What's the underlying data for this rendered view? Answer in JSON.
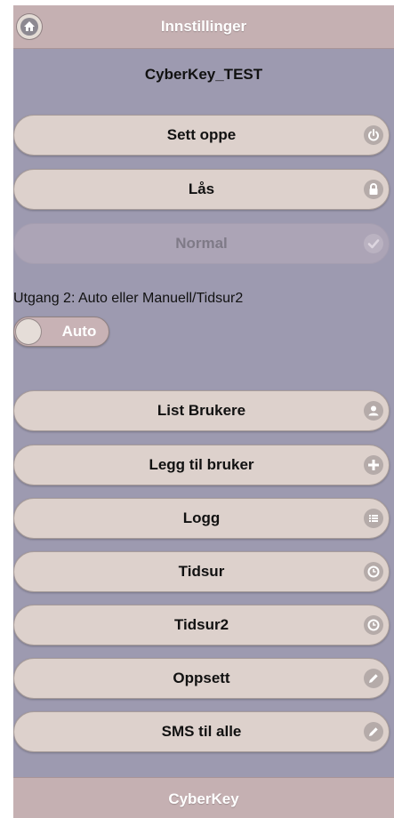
{
  "header": {
    "title": "Innstillinger",
    "home_icon": "home-icon"
  },
  "device": {
    "name": "CyberKey_TEST"
  },
  "actions": {
    "arm": {
      "label": "Sett oppe",
      "icon": "power-icon"
    },
    "lock": {
      "label": "Lås",
      "icon": "lock-icon"
    },
    "normal": {
      "label": "Normal",
      "icon": "check-icon",
      "disabled": true
    }
  },
  "output2": {
    "label": "Utgang 2: Auto eller Manuell/Tidsur2",
    "toggle_label": "Auto",
    "state": "off"
  },
  "menu": [
    {
      "label": "List Brukere",
      "icon": "user-icon"
    },
    {
      "label": "Legg til bruker",
      "icon": "plus-icon"
    },
    {
      "label": "Logg",
      "icon": "list-icon"
    },
    {
      "label": "Tidsur",
      "icon": "clock-icon"
    },
    {
      "label": "Tidsur2",
      "icon": "clock-icon"
    },
    {
      "label": "Oppsett",
      "icon": "edit-icon"
    },
    {
      "label": "SMS til alle",
      "icon": "edit-icon"
    }
  ],
  "footer": {
    "title": "CyberKey"
  },
  "colors": {
    "background": "#9d9ab0",
    "bar": "#c5b0b2",
    "button": "#ddd1cc",
    "icon_bg": "#b5aba9"
  }
}
